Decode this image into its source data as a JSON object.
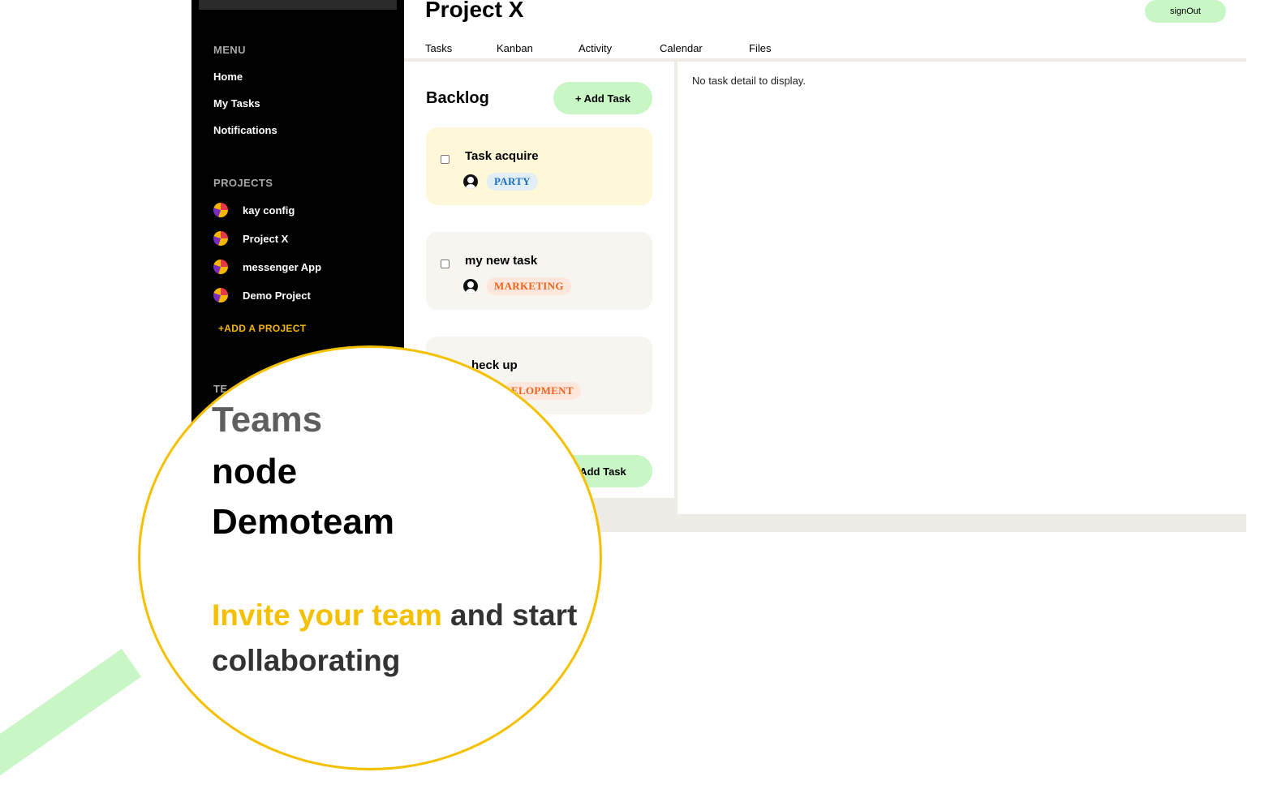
{
  "sidebar": {
    "menu_heading": "MENU",
    "menu_items": [
      "Home",
      "My Tasks",
      "Notifications"
    ],
    "projects_heading": "PROJECTS",
    "projects": [
      "kay config",
      "Project X",
      "messenger App",
      "Demo Project"
    ],
    "add_project": "+ADD A PROJECT",
    "teams_heading_partial": "TE"
  },
  "header": {
    "title": "Project X",
    "signout": "signOut",
    "tabs": [
      "Tasks",
      "Kanban",
      "Activity",
      "Calendar",
      "Files"
    ]
  },
  "backlog": {
    "title": "Backlog",
    "add_task": "+ Add Task",
    "add_task_bottom": "Add Task",
    "cards": [
      {
        "title": "Task acquire",
        "tag": "PARTY"
      },
      {
        "title": "my new task",
        "tag": "MARKETING"
      },
      {
        "title": "heck up",
        "tag": "ELOPMENT"
      }
    ]
  },
  "detail": {
    "empty_text": "No task detail to display."
  },
  "magnifier": {
    "teams": "Teams",
    "team_1": "node",
    "team_2": "Demoteam",
    "invite_highlight": "Invite your team",
    "invite_rest": " and start collaborating"
  },
  "colors": {
    "accent_green": "#c8f7c5",
    "accent_yellow": "#f5c000",
    "sidebar_bg": "#000000",
    "tag_blue": "#1e6fc0",
    "tag_orange": "#f0641e"
  }
}
